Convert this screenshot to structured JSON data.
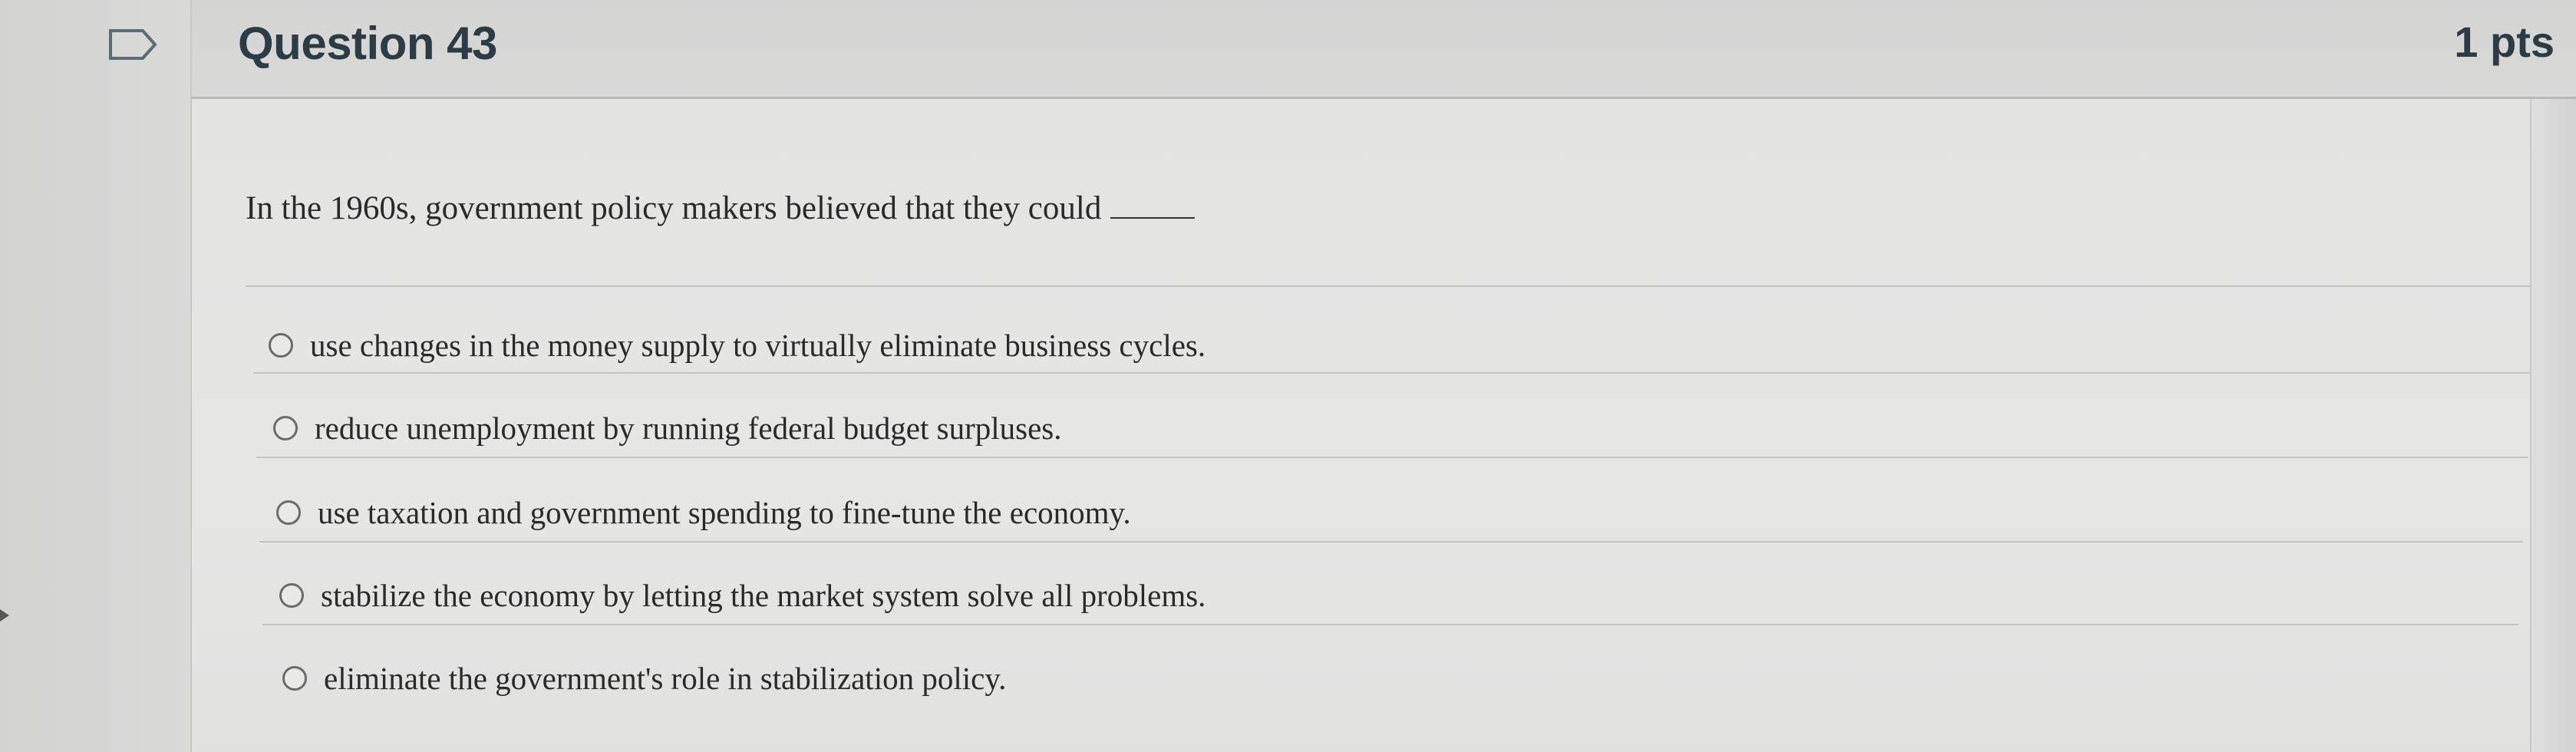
{
  "question": {
    "title": "Question 43",
    "points": "1 pts",
    "prompt": "In the 1960s, government policy makers believed that they could"
  },
  "answers": [
    {
      "label": "use changes in the money supply to virtually eliminate business cycles."
    },
    {
      "label": "reduce unemployment by running federal budget surpluses."
    },
    {
      "label": "use taxation and government spending to fine-tune the economy."
    },
    {
      "label": "stabilize the economy by letting the market system solve all problems."
    },
    {
      "label": "eliminate the government's role in stabilization policy."
    }
  ],
  "icons": {
    "bookmark": "bookmark-flag-icon",
    "radio": "radio-unselected-icon"
  },
  "colors": {
    "title": "#2d3b45",
    "background": "#dcdcdb"
  }
}
